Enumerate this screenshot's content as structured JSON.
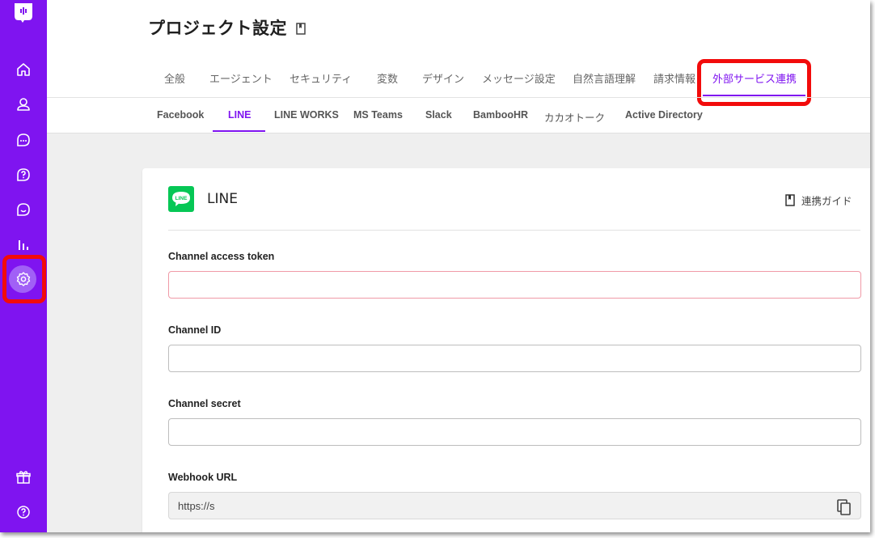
{
  "header": {
    "title": "プロジェクト設定"
  },
  "tabs": [
    {
      "label": "全般"
    },
    {
      "label": "エージェント"
    },
    {
      "label": "セキュリティ"
    },
    {
      "label": "変数"
    },
    {
      "label": "デザイン"
    },
    {
      "label": "メッセージ設定"
    },
    {
      "label": "自然言語理解"
    },
    {
      "label": "請求情報"
    },
    {
      "label": "外部サービス連携"
    }
  ],
  "subtabs": [
    {
      "label": "Facebook"
    },
    {
      "label": "LINE"
    },
    {
      "label": "LINE WORKS"
    },
    {
      "label": "MS Teams"
    },
    {
      "label": "Slack"
    },
    {
      "label": "BambooHR"
    },
    {
      "label": "カカオトーク"
    },
    {
      "label": "Active Directory"
    }
  ],
  "card": {
    "logo_text": "LINE",
    "title": "LINE",
    "guide_label": "連携ガイド",
    "fields": [
      {
        "label": "Channel access token",
        "value": ""
      },
      {
        "label": "Channel ID",
        "value": ""
      },
      {
        "label": "Channel secret",
        "value": ""
      },
      {
        "label": "Webhook URL",
        "value": "https://s"
      }
    ]
  },
  "colors": {
    "accent": "#7f14f0",
    "line_green": "#06c755",
    "highlight": "#f20b0b"
  }
}
